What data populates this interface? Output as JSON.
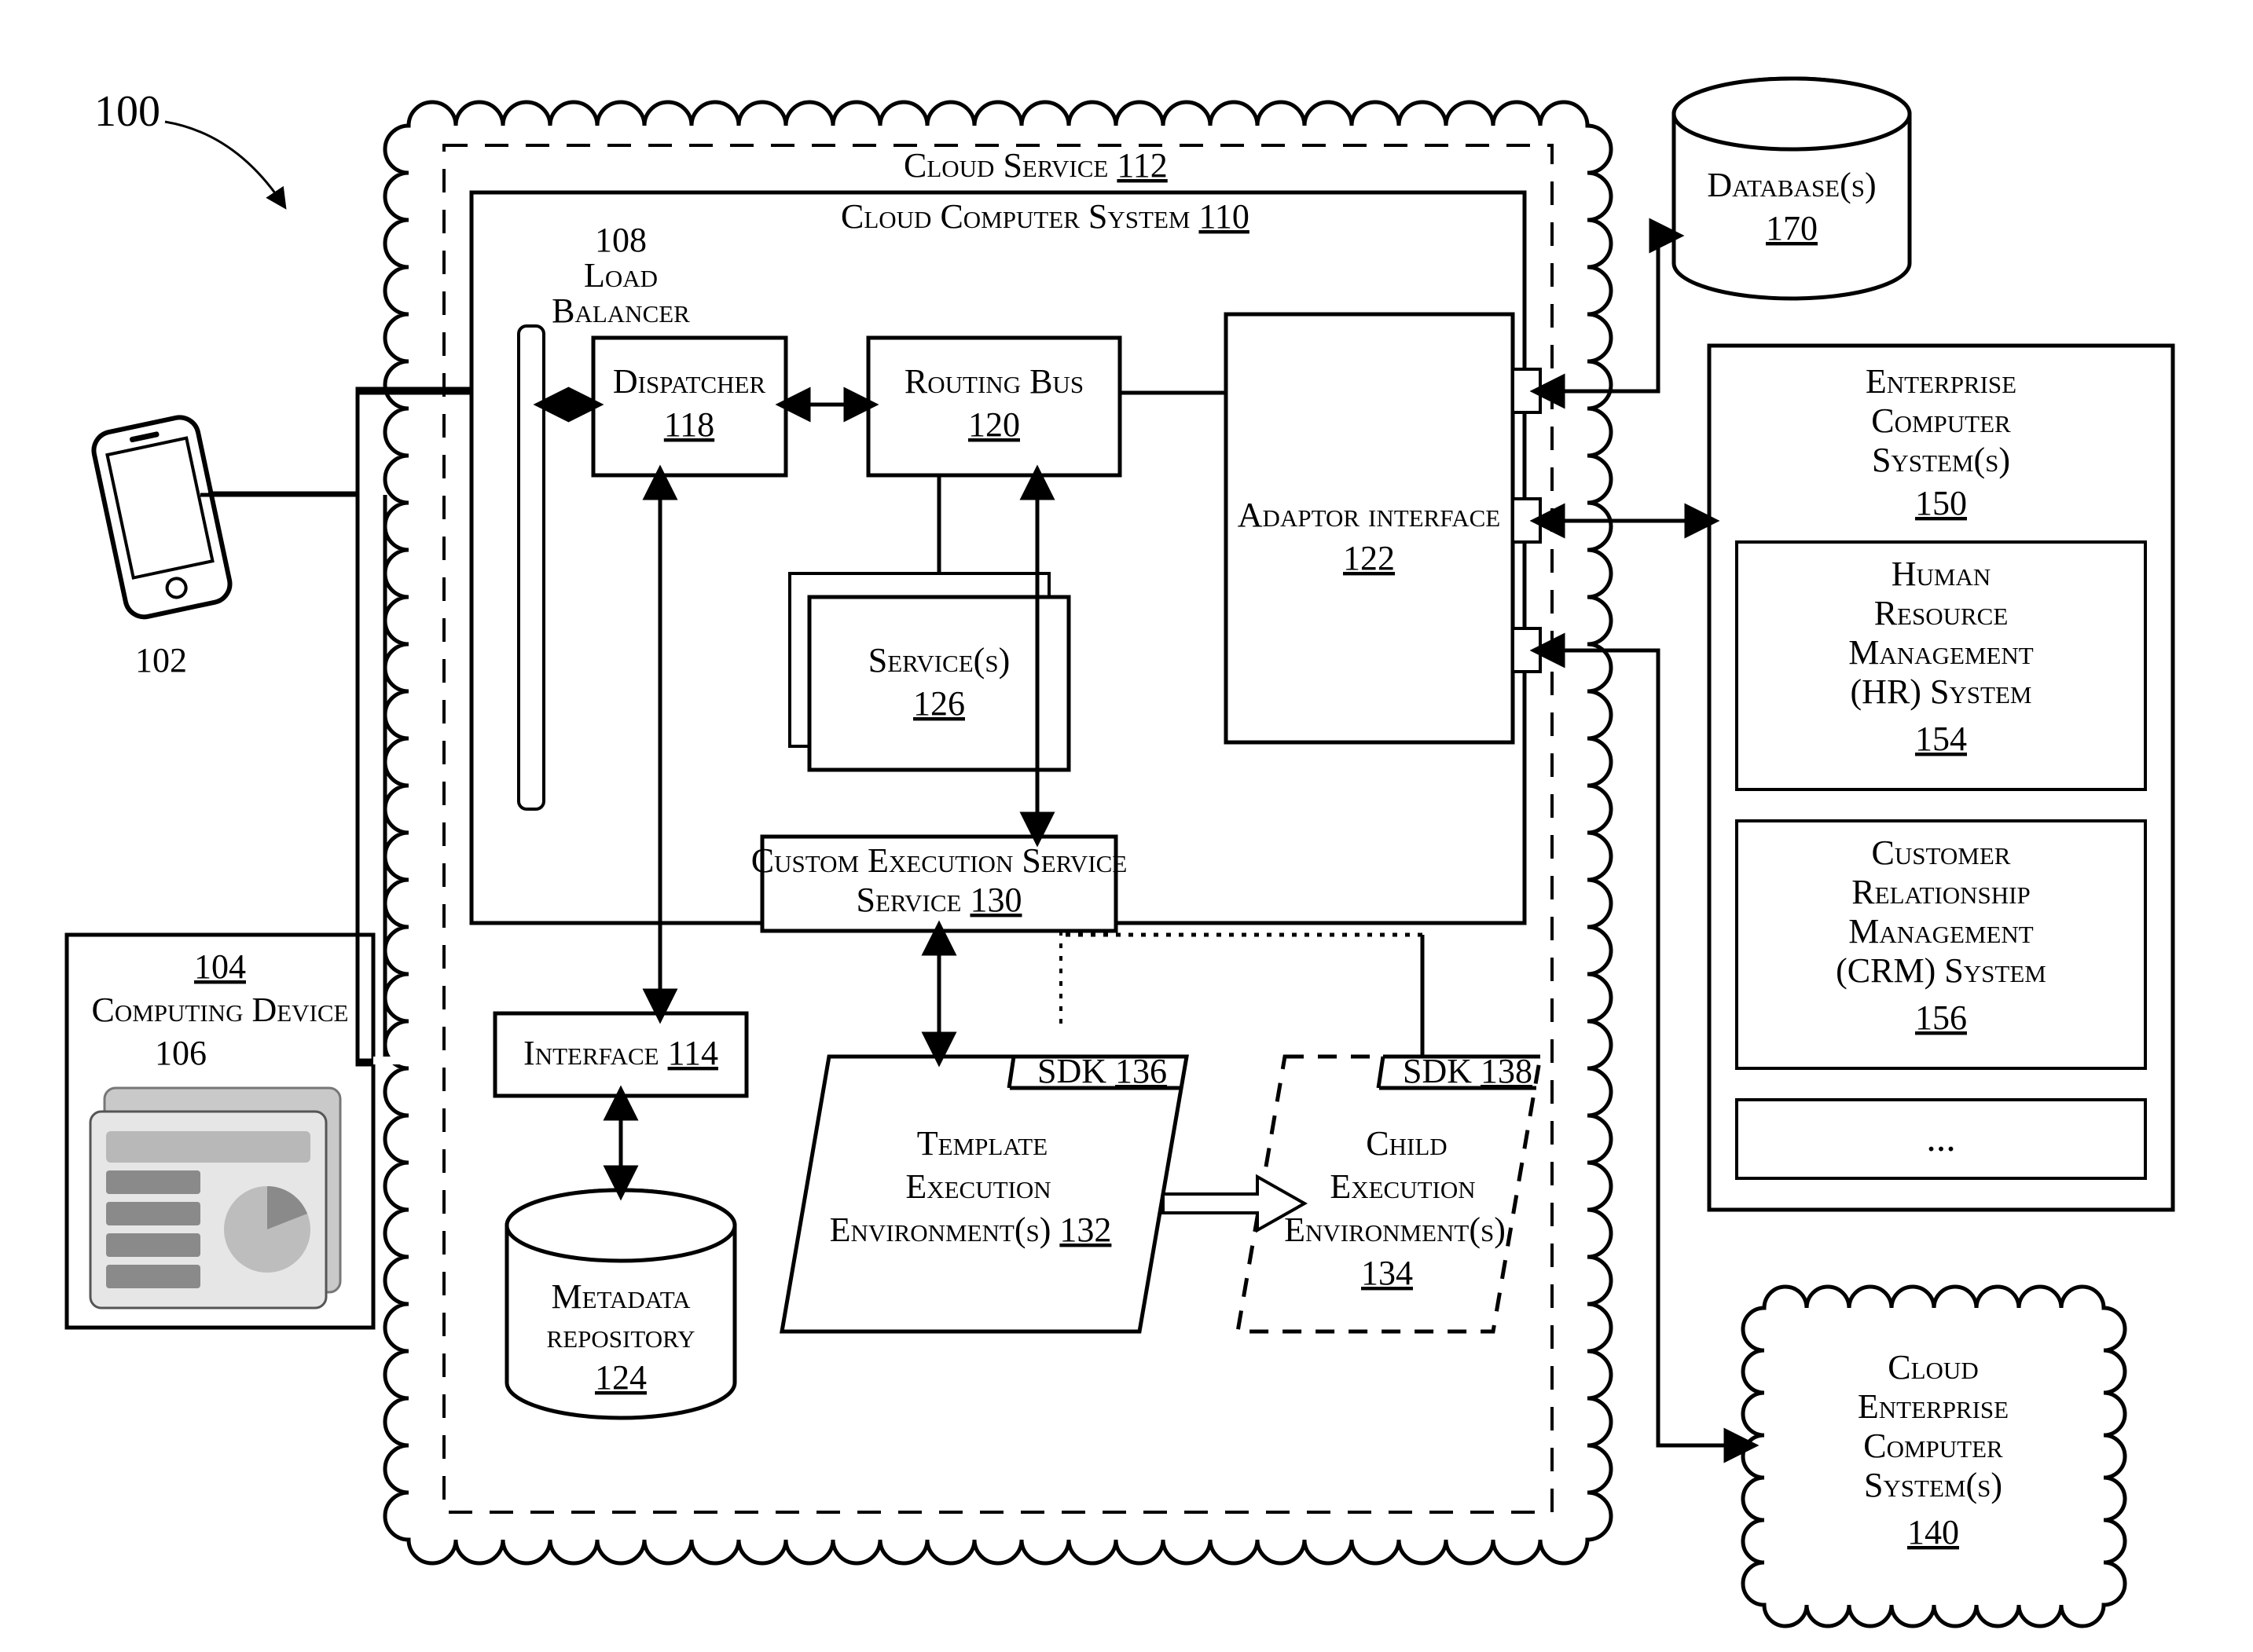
{
  "figure_label": "100",
  "mobile_ref": "102",
  "computing_device": {
    "title": "Computing Device",
    "num": "104",
    "sub": "106"
  },
  "cloud_service": {
    "title": "Cloud Service",
    "num": "112"
  },
  "cloud_system": {
    "title": "Cloud Computer System",
    "num": "110"
  },
  "load_balancer": {
    "label_top": "108",
    "label_bottom": "Load Balancer"
  },
  "dispatcher": {
    "title": "Dispatcher",
    "num": "118"
  },
  "routing_bus": {
    "title": "Routing Bus",
    "num": "120"
  },
  "services": {
    "title": "Service(s)",
    "num": "126"
  },
  "custom_exec": {
    "title": "Custom Execution Service",
    "num": "130"
  },
  "adaptor": {
    "title": "Adaptor interface",
    "num": "122"
  },
  "interface": {
    "title": "Interface",
    "num": "114"
  },
  "metadata": {
    "title": "Metadata repository",
    "num": "124"
  },
  "sdk_template": {
    "label": "SDK",
    "num": "136"
  },
  "template_env": {
    "title1": "Template",
    "title2": "Execution",
    "title3": "Environment(s)",
    "num": "132"
  },
  "sdk_child": {
    "label": "SDK",
    "num": "138"
  },
  "child_env": {
    "title1": "Child",
    "title2": "Execution",
    "title3": "Environment(s)",
    "num": "134"
  },
  "databases": {
    "title": "Database(s)",
    "num": "170"
  },
  "enterprise": {
    "title": "Enterprise Computer System(s)",
    "num": "150",
    "hr": {
      "title": "Human Resource Management (HR) System",
      "num": "154"
    },
    "crm": {
      "title": "Customer Relationship Management (CRM) System",
      "num": "156"
    },
    "more": "..."
  },
  "cloud_ent": {
    "title": "Cloud Enterprise Computer System(s)",
    "num": "140"
  }
}
